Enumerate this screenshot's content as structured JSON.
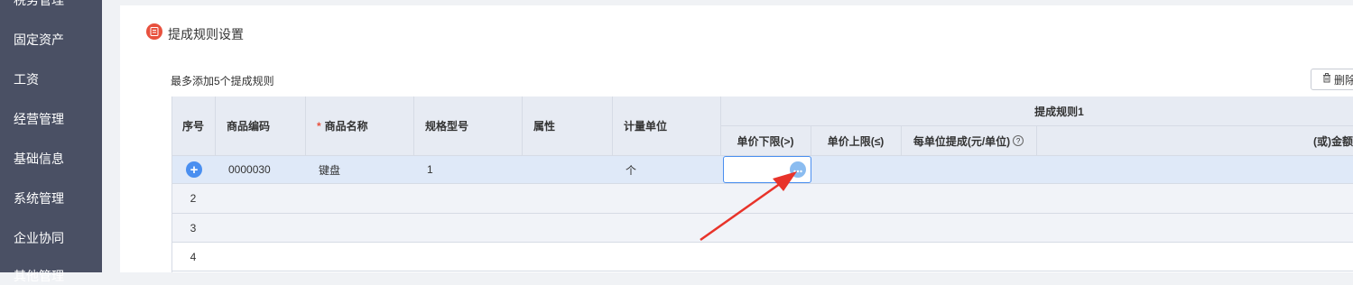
{
  "sidebar": {
    "items": [
      {
        "label": "税务管理"
      },
      {
        "label": "固定资产"
      },
      {
        "label": "工资"
      },
      {
        "label": "经营管理"
      },
      {
        "label": "基础信息"
      },
      {
        "label": "系统管理"
      },
      {
        "label": "企业协同"
      },
      {
        "label": "其他管理"
      }
    ]
  },
  "section": {
    "title": "提成规则设置"
  },
  "hint": "最多添加5个提成规则",
  "toolbar": {
    "delete_label": "删除"
  },
  "table": {
    "headers": {
      "index": "序号",
      "code": "商品编码",
      "required_mark": "*",
      "name": "商品名称",
      "spec": "规格型号",
      "attr": "属性",
      "unit": "计量单位",
      "rule_group": "提成规则1",
      "lower": "单价下限(>)",
      "upper": "单价上限(≤)",
      "per_unit": "每单位提成(元/单位)",
      "or_amount": "(或)金额"
    },
    "rows": [
      {
        "index": "+",
        "code": "0000030",
        "name": "键盘",
        "spec": "1",
        "attr": "",
        "unit": "个"
      },
      {
        "index": "2"
      },
      {
        "index": "3"
      },
      {
        "index": "4"
      }
    ]
  },
  "colors": {
    "sidebar": "#4a5064",
    "accent": "#4a8ff0",
    "icon_red": "#e8513e",
    "arrow": "#e8332a"
  }
}
